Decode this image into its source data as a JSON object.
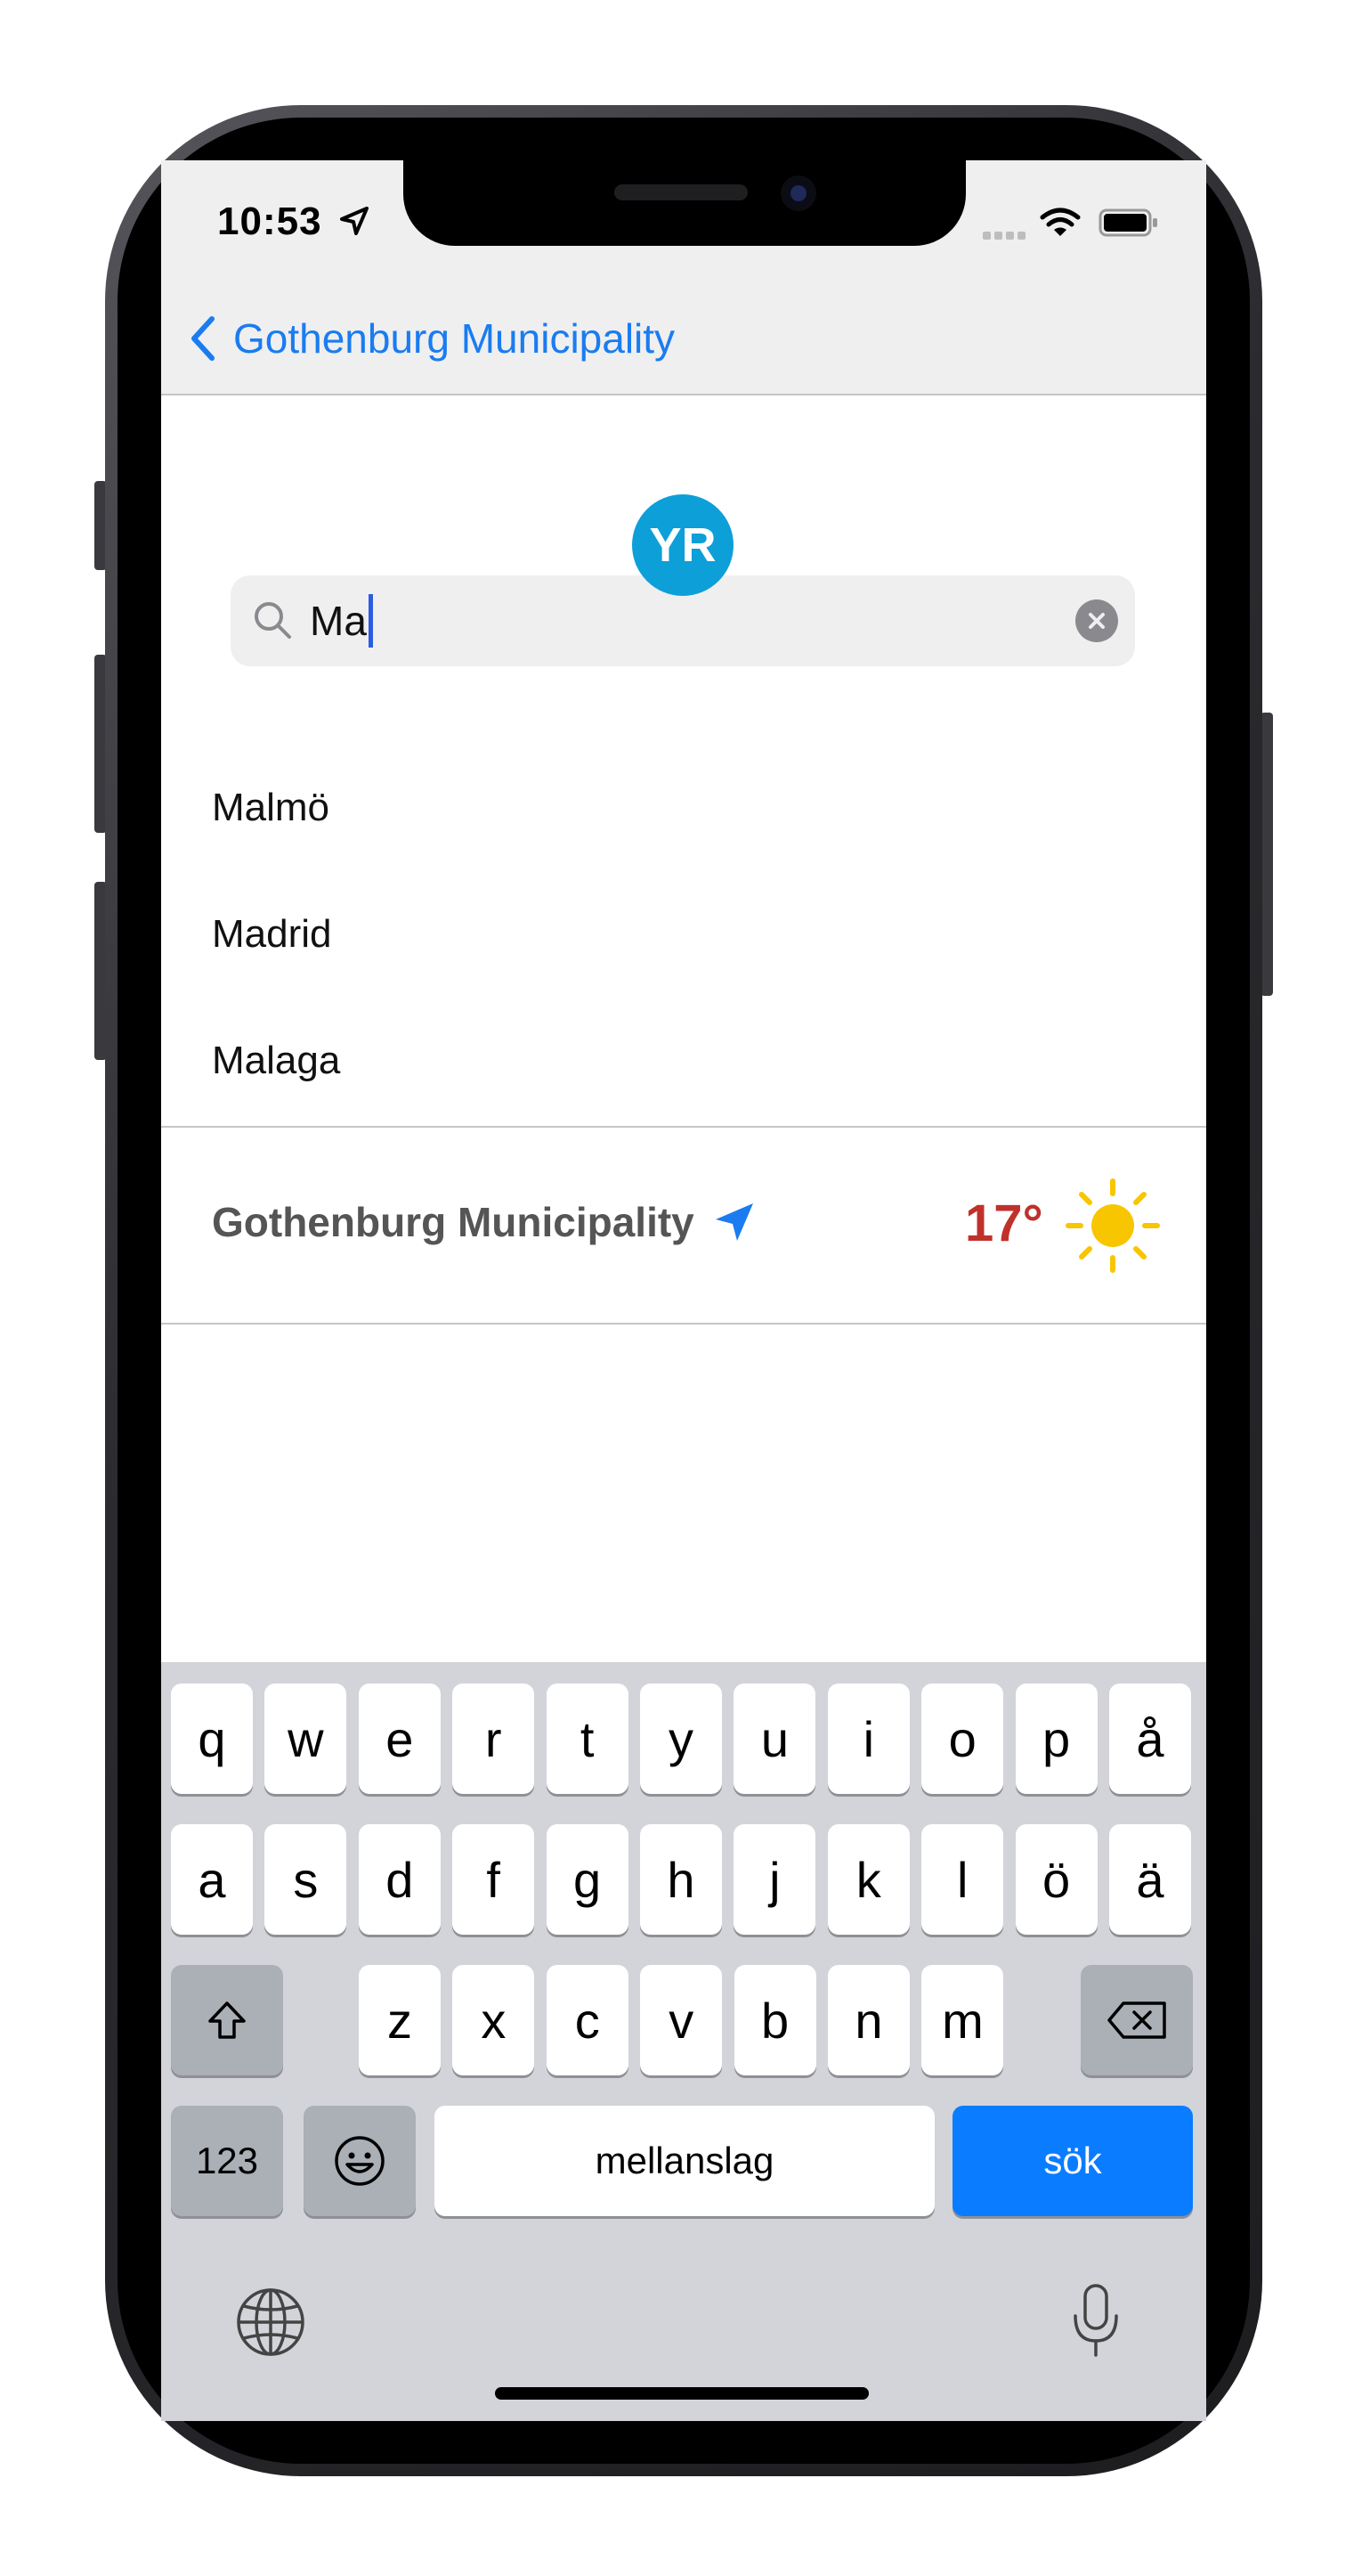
{
  "status_bar": {
    "time": "10:53"
  },
  "nav": {
    "back_label": "Gothenburg Municipality"
  },
  "logo": {
    "text": "YR",
    "color": "#0d9fd8"
  },
  "search": {
    "value": "Ma"
  },
  "results": [
    {
      "name": "Malmö"
    },
    {
      "name": "Madrid"
    },
    {
      "name": "Malaga"
    }
  ],
  "current_location": {
    "name": "Gothenburg Municipality",
    "temperature": "17°",
    "temperature_color": "#c0312c",
    "weather_icon": "sun-icon",
    "location_icon": "location-arrow-icon"
  },
  "keyboard": {
    "row1": [
      "q",
      "w",
      "e",
      "r",
      "t",
      "y",
      "u",
      "i",
      "o",
      "p",
      "å"
    ],
    "row2": [
      "a",
      "s",
      "d",
      "f",
      "g",
      "h",
      "j",
      "k",
      "l",
      "ö",
      "ä"
    ],
    "row3": [
      "z",
      "x",
      "c",
      "v",
      "b",
      "n",
      "m"
    ],
    "numbers_label": "123",
    "space_label": "mellanslag",
    "search_label": "sök",
    "accent_color": "#0a7cff"
  }
}
